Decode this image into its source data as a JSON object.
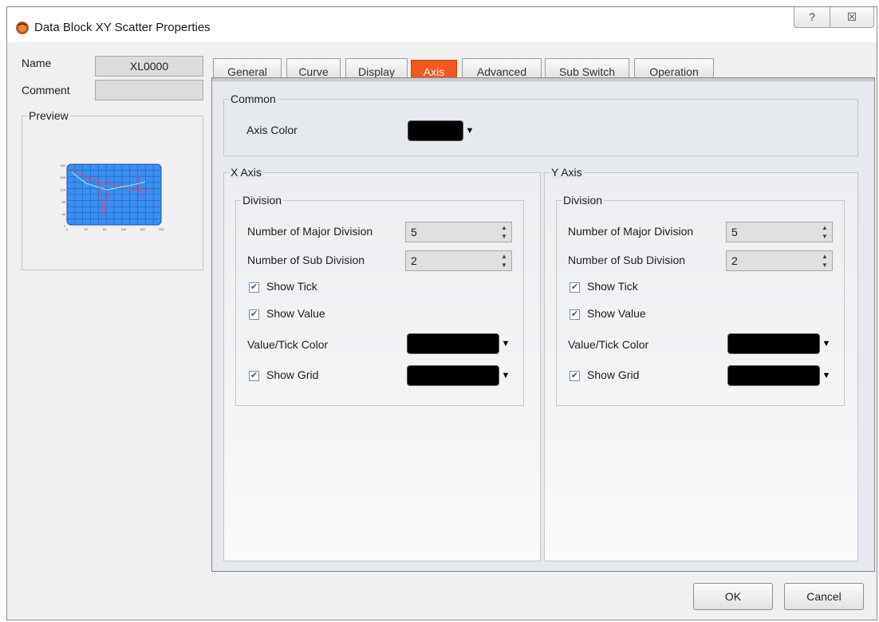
{
  "window": {
    "title": "Data Block XY Scatter Properties",
    "help_glyph": "?",
    "close_glyph": "☒"
  },
  "left_panel": {
    "name_label": "Name",
    "name_value": "XL0000",
    "comment_label": "Comment",
    "comment_value": "",
    "preview_label": "Preview"
  },
  "preview_chart": {
    "y_ticks": [
      "180",
      "160",
      "120",
      "80",
      "40",
      "0"
    ],
    "x_ticks": [
      "0",
      "20",
      "60",
      "100",
      "160",
      "200"
    ],
    "colors": {
      "plot_background": "#3b8ff0",
      "grid": "#1c62c0",
      "series_a": "#e24a6a",
      "series_b": "#7fe0f0"
    }
  },
  "tabs": [
    {
      "label": "General",
      "active": false
    },
    {
      "label": "Curve",
      "active": false
    },
    {
      "label": "Display",
      "active": false
    },
    {
      "label": "Axis",
      "active": true
    },
    {
      "label": "Advanced",
      "active": false
    },
    {
      "label": "Sub Switch",
      "active": false
    },
    {
      "label": "Operation",
      "active": false
    }
  ],
  "axis_tab": {
    "common": {
      "title": "Common",
      "axis_color_label": "Axis Color",
      "axis_color": "#000000"
    },
    "x_axis": {
      "title": "X Axis",
      "division_title": "Division",
      "major_label": "Number of Major Division",
      "major_value": "5",
      "sub_label": "Number of Sub Division",
      "sub_value": "2",
      "show_tick_label": "Show Tick",
      "show_tick": true,
      "show_value_label": "Show Value",
      "show_value": true,
      "value_tick_color_label": "Value/Tick Color",
      "value_tick_color": "#000000",
      "show_grid_label": "Show Grid",
      "show_grid": true,
      "grid_color": "#000000"
    },
    "y_axis": {
      "title": "Y Axis",
      "division_title": "Division",
      "major_label": "Number of Major Division",
      "major_value": "5",
      "sub_label": "Number of Sub Division",
      "sub_value": "2",
      "show_tick_label": "Show Tick",
      "show_tick": true,
      "show_value_label": "Show Value",
      "show_value": true,
      "value_tick_color_label": "Value/Tick Color",
      "value_tick_color": "#000000",
      "show_grid_label": "Show Grid",
      "show_grid": true,
      "grid_color": "#000000"
    }
  },
  "buttons": {
    "ok": "OK",
    "cancel": "Cancel"
  },
  "ui": {
    "check_glyph": "✔",
    "dropdown_glyph": "▼",
    "spin_up": "▲",
    "spin_down": "▼"
  }
}
